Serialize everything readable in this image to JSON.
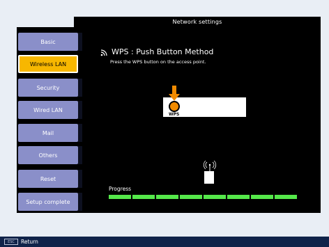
{
  "window": {
    "title": "Network settings"
  },
  "sidebar": {
    "items": [
      {
        "label": "Basic"
      },
      {
        "label": "Wireless LAN"
      },
      {
        "label": "Security"
      },
      {
        "label": "Wired LAN"
      },
      {
        "label": "Mail"
      },
      {
        "label": "Others"
      },
      {
        "label": "Reset"
      },
      {
        "label": "Setup complete"
      }
    ],
    "active_index": 1
  },
  "main": {
    "title": "WPS : Push Button Method",
    "instruction": "Press the WPS button on the access point.",
    "wps_label": "WPS",
    "progress_label": "Progress",
    "progress_segments": 8
  },
  "footer": {
    "key_label": "ESC",
    "action_label": "Return"
  },
  "colors": {
    "sidebar_button": "#8a8fc9",
    "active_button": "#f7b700",
    "progress": "#55e84a",
    "arrow": "#f08a00"
  }
}
